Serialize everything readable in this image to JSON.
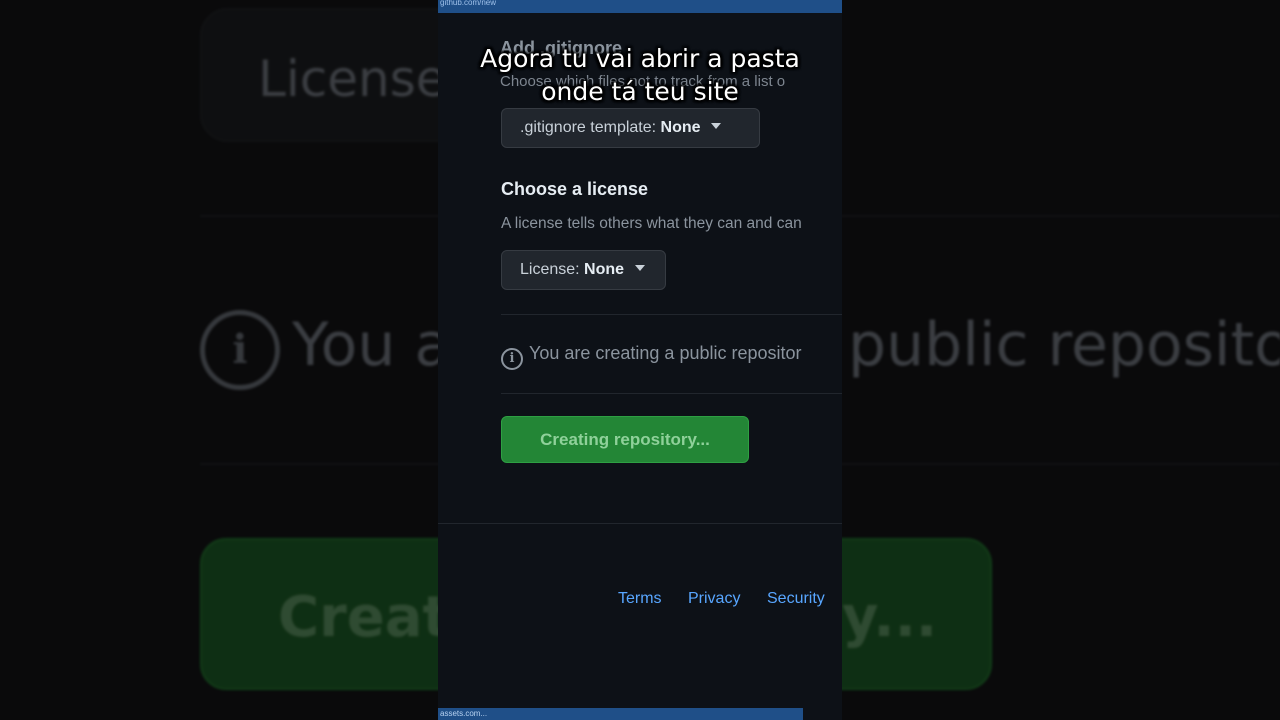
{
  "background": {
    "license_fragment": "License",
    "you_fragment": "You a",
    "public_fragment": "public repositor",
    "create_fragment": "Creat",
    "dots_fragment": "y..."
  },
  "browser": {
    "url": "github.com/new",
    "status_text": "assets.com..."
  },
  "caption": {
    "line1": "Agora tu vai abrir a pasta",
    "line2": "onde tá teu site"
  },
  "gitignore": {
    "heading": "Add .gitignore",
    "description": "Choose which files not to track from a list o",
    "dropdown_label": ".gitignore template:",
    "dropdown_value": "None"
  },
  "license": {
    "heading": "Choose a license",
    "description": "A license tells others what they can and can",
    "dropdown_label": "License:",
    "dropdown_value": "None"
  },
  "notice": {
    "text": "You are creating a public repositor"
  },
  "create_button": {
    "label": "Creating repository..."
  },
  "footer": {
    "links": [
      "Terms",
      "Privacy",
      "Security"
    ]
  },
  "colors": {
    "page_bg": "#0d1117",
    "accent_green": "#238636",
    "link_blue": "#58a6ff"
  }
}
